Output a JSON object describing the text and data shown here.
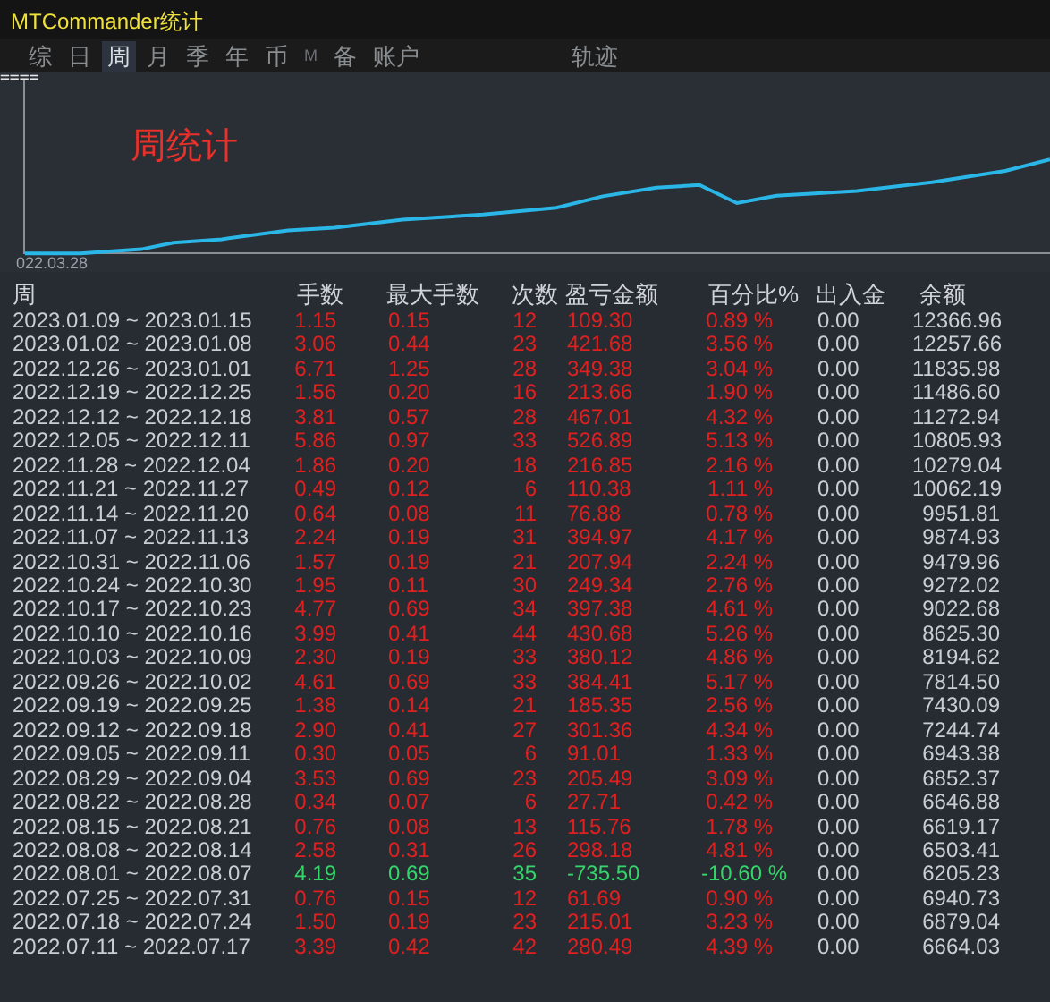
{
  "window": {
    "title": "MTCommander统计"
  },
  "tabs": [
    {
      "label": "综",
      "selected": false,
      "disabled": false
    },
    {
      "label": "日",
      "selected": false,
      "disabled": false
    },
    {
      "label": "周",
      "selected": true,
      "disabled": false
    },
    {
      "label": "月",
      "selected": false,
      "disabled": false
    },
    {
      "label": "季",
      "selected": false,
      "disabled": false
    },
    {
      "label": "年",
      "selected": false,
      "disabled": false
    },
    {
      "label": "币",
      "selected": false,
      "disabled": false
    },
    {
      "label": "M",
      "selected": false,
      "disabled": true
    },
    {
      "label": "备",
      "selected": false,
      "disabled": false
    },
    {
      "label": "账户",
      "selected": false,
      "disabled": false
    }
  ],
  "trail_tab": {
    "label": "轨迹",
    "selected": false
  },
  "chart": {
    "marker": "====",
    "label": "周统计",
    "x_start": "022.03.28"
  },
  "table": {
    "columns": [
      "周",
      "手数",
      "最大手数",
      "次数",
      "盈亏金额",
      "百分比%",
      "出入金",
      "余额"
    ],
    "rows": [
      {
        "kind": "gain",
        "cells": [
          "2023.01.09 ~ 2023.01.15",
          "1.15",
          "0.15",
          "12",
          "109.30",
          "0.89 %",
          "0.00",
          "12366.96"
        ]
      },
      {
        "kind": "gain",
        "cells": [
          "2023.01.02 ~ 2023.01.08",
          "3.06",
          "0.44",
          "23",
          "421.68",
          "3.56 %",
          "0.00",
          "12257.66"
        ]
      },
      {
        "kind": "gain",
        "cells": [
          "2022.12.26 ~ 2023.01.01",
          "6.71",
          "1.25",
          "28",
          "349.38",
          "3.04 %",
          "0.00",
          "11835.98"
        ]
      },
      {
        "kind": "gain",
        "cells": [
          "2022.12.19 ~ 2022.12.25",
          "1.56",
          "0.20",
          "16",
          "213.66",
          "1.90 %",
          "0.00",
          "11486.60"
        ]
      },
      {
        "kind": "gain",
        "cells": [
          "2022.12.12 ~ 2022.12.18",
          "3.81",
          "0.57",
          "28",
          "467.01",
          "4.32 %",
          "0.00",
          "11272.94"
        ]
      },
      {
        "kind": "gain",
        "cells": [
          "2022.12.05 ~ 2022.12.11",
          "5.86",
          "0.97",
          "33",
          "526.89",
          "5.13 %",
          "0.00",
          "10805.93"
        ]
      },
      {
        "kind": "gain",
        "cells": [
          "2022.11.28 ~ 2022.12.04",
          "1.86",
          "0.20",
          "18",
          "216.85",
          "2.16 %",
          "0.00",
          "10279.04"
        ]
      },
      {
        "kind": "gain",
        "cells": [
          "2022.11.21 ~ 2022.11.27",
          "0.49",
          "0.12",
          "6",
          "110.38",
          "1.11 %",
          "0.00",
          "10062.19"
        ]
      },
      {
        "kind": "gain",
        "cells": [
          "2022.11.14 ~ 2022.11.20",
          "0.64",
          "0.08",
          "11",
          "76.88",
          "0.78 %",
          "0.00",
          "9951.81"
        ]
      },
      {
        "kind": "gain",
        "cells": [
          "2022.11.07 ~ 2022.11.13",
          "2.24",
          "0.19",
          "31",
          "394.97",
          "4.17 %",
          "0.00",
          "9874.93"
        ]
      },
      {
        "kind": "gain",
        "cells": [
          "2022.10.31 ~ 2022.11.06",
          "1.57",
          "0.19",
          "21",
          "207.94",
          "2.24 %",
          "0.00",
          "9479.96"
        ]
      },
      {
        "kind": "gain",
        "cells": [
          "2022.10.24 ~ 2022.10.30",
          "1.95",
          "0.11",
          "30",
          "249.34",
          "2.76 %",
          "0.00",
          "9272.02"
        ]
      },
      {
        "kind": "gain",
        "cells": [
          "2022.10.17 ~ 2022.10.23",
          "4.77",
          "0.69",
          "34",
          "397.38",
          "4.61 %",
          "0.00",
          "9022.68"
        ]
      },
      {
        "kind": "gain",
        "cells": [
          "2022.10.10 ~ 2022.10.16",
          "3.99",
          "0.41",
          "44",
          "430.68",
          "5.26 %",
          "0.00",
          "8625.30"
        ]
      },
      {
        "kind": "gain",
        "cells": [
          "2022.10.03 ~ 2022.10.09",
          "2.30",
          "0.19",
          "33",
          "380.12",
          "4.86 %",
          "0.00",
          "8194.62"
        ]
      },
      {
        "kind": "gain",
        "cells": [
          "2022.09.26 ~ 2022.10.02",
          "4.61",
          "0.69",
          "33",
          "384.41",
          "5.17 %",
          "0.00",
          "7814.50"
        ]
      },
      {
        "kind": "gain",
        "cells": [
          "2022.09.19 ~ 2022.09.25",
          "1.38",
          "0.14",
          "21",
          "185.35",
          "2.56 %",
          "0.00",
          "7430.09"
        ]
      },
      {
        "kind": "gain",
        "cells": [
          "2022.09.12 ~ 2022.09.18",
          "2.90",
          "0.41",
          "27",
          "301.36",
          "4.34 %",
          "0.00",
          "7244.74"
        ]
      },
      {
        "kind": "gain",
        "cells": [
          "2022.09.05 ~ 2022.09.11",
          "0.30",
          "0.05",
          "6",
          "91.01",
          "1.33 %",
          "0.00",
          "6943.38"
        ]
      },
      {
        "kind": "gain",
        "cells": [
          "2022.08.29 ~ 2022.09.04",
          "3.53",
          "0.69",
          "23",
          "205.49",
          "3.09 %",
          "0.00",
          "6852.37"
        ]
      },
      {
        "kind": "gain",
        "cells": [
          "2022.08.22 ~ 2022.08.28",
          "0.34",
          "0.07",
          "6",
          "27.71",
          "0.42 %",
          "0.00",
          "6646.88"
        ]
      },
      {
        "kind": "gain",
        "cells": [
          "2022.08.15 ~ 2022.08.21",
          "0.76",
          "0.08",
          "13",
          "115.76",
          "1.78 %",
          "0.00",
          "6619.17"
        ]
      },
      {
        "kind": "gain",
        "cells": [
          "2022.08.08 ~ 2022.08.14",
          "2.58",
          "0.31",
          "26",
          "298.18",
          "4.81 %",
          "0.00",
          "6503.41"
        ]
      },
      {
        "kind": "loss",
        "cells": [
          "2022.08.01 ~ 2022.08.07",
          "4.19",
          "0.69",
          "35",
          "-735.50",
          "-10.60 %",
          "0.00",
          "6205.23"
        ]
      },
      {
        "kind": "gain",
        "cells": [
          "2022.07.25 ~ 2022.07.31",
          "0.76",
          "0.15",
          "12",
          "61.69",
          "0.90 %",
          "0.00",
          "6940.73"
        ]
      },
      {
        "kind": "gain",
        "cells": [
          "2022.07.18 ~ 2022.07.24",
          "1.50",
          "0.19",
          "23",
          "215.01",
          "3.23 %",
          "0.00",
          "6879.04"
        ]
      },
      {
        "kind": "gain",
        "cells": [
          "2022.07.11 ~ 2022.07.17",
          "3.39",
          "0.42",
          "42",
          "280.49",
          "4.39 %",
          "0.00",
          "6664.03"
        ]
      }
    ]
  }
}
